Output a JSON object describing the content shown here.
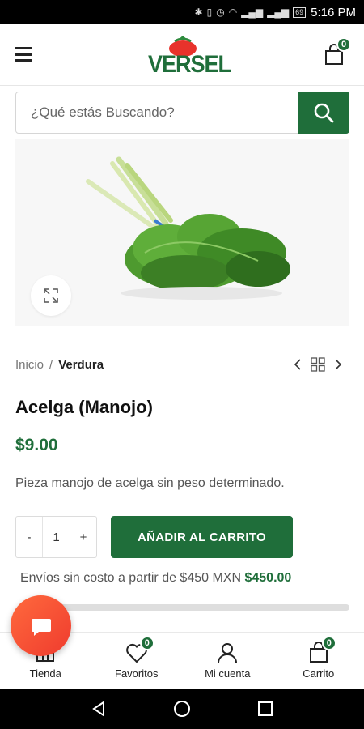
{
  "status_bar": {
    "time": "5:16 PM",
    "battery": "69"
  },
  "header": {
    "logo_text": "VERSEL",
    "cart_count": "0"
  },
  "search": {
    "placeholder": "¿Qué estás Buscando?"
  },
  "breadcrumb": {
    "home": "Inicio",
    "separator": "/",
    "current": "Verdura"
  },
  "product": {
    "title": "Acelga (Manojo)",
    "price": "$9.00",
    "description": "Pieza manojo de acelga sin peso determinado.",
    "quantity": "1",
    "minus_label": "-",
    "plus_label": "+",
    "add_to_cart_label": "AÑADIR AL CARRITO"
  },
  "shipping": {
    "text": "Envíos sin costo a partir de $450 MXN",
    "amount": "$450.00",
    "progress_fraction": 0.0
  },
  "bottom_nav": {
    "items": [
      {
        "label": "Tienda",
        "icon": "store-icon"
      },
      {
        "label": "Favoritos",
        "icon": "heart-icon",
        "badge": "0"
      },
      {
        "label": "Mi cuenta",
        "icon": "user-icon"
      },
      {
        "label": "Carrito",
        "icon": "cart-icon",
        "badge": "0"
      }
    ]
  },
  "colors": {
    "brand_green": "#1f6e3a",
    "chat_orange": "#ef3b2e"
  }
}
